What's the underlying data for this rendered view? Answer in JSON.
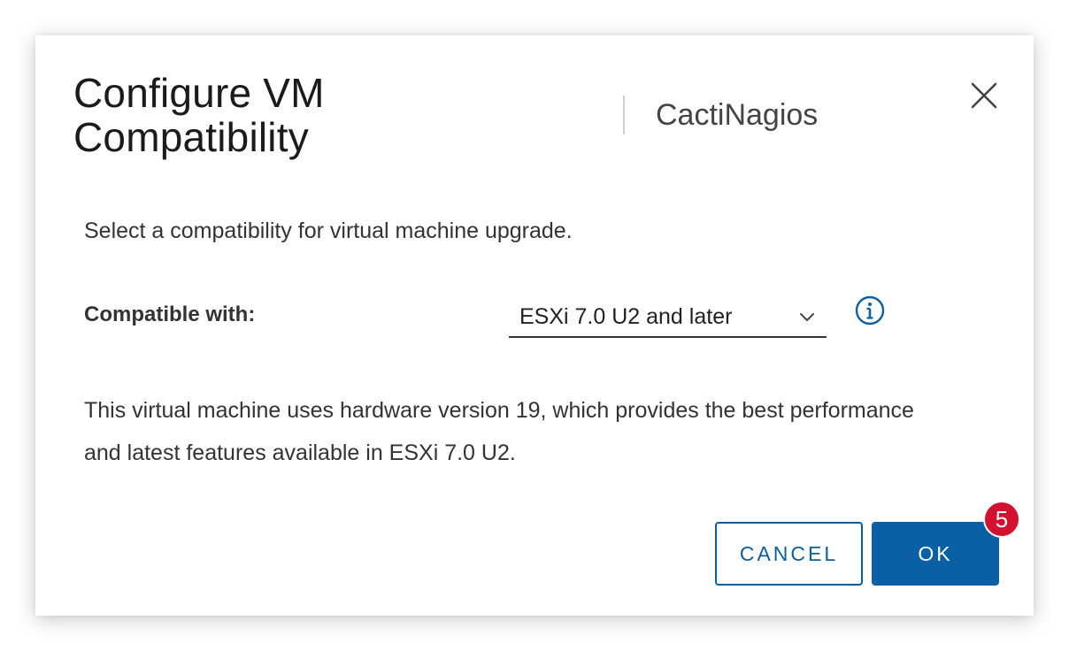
{
  "dialog": {
    "title": "Configure VM Compatibility",
    "subtitle": "CactiNagios",
    "close_icon": "close-icon",
    "intro": "Select a compatibility for virtual machine upgrade.",
    "compatibility": {
      "label": "Compatible with:",
      "selected": "ESXi 7.0 U2 and later",
      "chevron_icon": "chevron-down-icon",
      "info_icon": "info-icon"
    },
    "description": "This virtual machine uses hardware version 19, which provides the best performance and latest features available in ESXi 7.0 U2.",
    "buttons": {
      "cancel": "CANCEL",
      "ok": "OK"
    },
    "step_badge": "5"
  },
  "colors": {
    "primary": "#0b5fa4",
    "badge": "#d2122e",
    "text": "#333333"
  }
}
